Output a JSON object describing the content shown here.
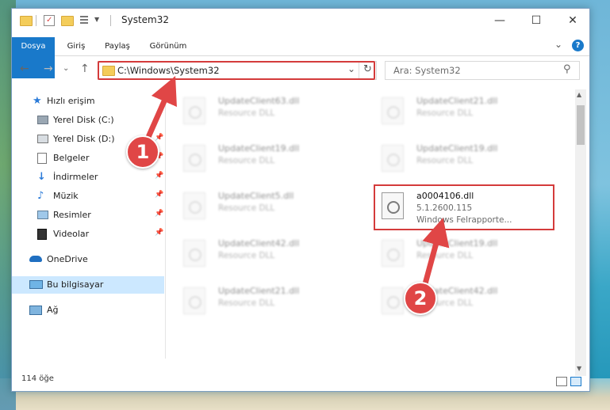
{
  "window": {
    "title": "System32",
    "controls": {
      "minimize": "—",
      "maximize": "☐",
      "close": "✕"
    }
  },
  "ribbon": {
    "tabs": [
      "Dosya",
      "Giriş",
      "Paylaş",
      "Görünüm"
    ],
    "expand": "⌄",
    "help": "?"
  },
  "nav": {
    "back": "←",
    "forward": "→",
    "dropdown": "⌄",
    "up": "↑",
    "address": "C:\\Windows\\System32",
    "address_dropdown": "⌄",
    "refresh": "↻",
    "search_placeholder": "Ara: System32",
    "search_icon": "⚲"
  },
  "sidebar": {
    "items": [
      {
        "label": "Hızlı erişim",
        "icon": "star-icon"
      },
      {
        "label": "Yerel Disk (C:)",
        "icon": "drive-icon",
        "pinned": true
      },
      {
        "label": "Yerel Disk (D:)",
        "icon": "drive-icon",
        "pinned": true
      },
      {
        "label": "Belgeler",
        "icon": "documents-icon",
        "pinned": true
      },
      {
        "label": "İndirmeler",
        "icon": "download-icon",
        "pinned": true
      },
      {
        "label": "Müzik",
        "icon": "music-icon",
        "pinned": true
      },
      {
        "label": "Resimler",
        "icon": "pictures-icon",
        "pinned": true
      },
      {
        "label": "Videolar",
        "icon": "video-icon",
        "pinned": true
      },
      {
        "label": "OneDrive",
        "icon": "cloud-icon"
      },
      {
        "label": "Bu bilgisayar",
        "icon": "computer-icon",
        "selected": true
      },
      {
        "label": "Ağ",
        "icon": "network-icon"
      }
    ]
  },
  "files": {
    "left": [
      {
        "name": "UpdateClient63.dll",
        "desc": "Resource DLL"
      },
      {
        "name": "UpdateClient19.dll",
        "desc": "Resource DLL"
      },
      {
        "name": "UpdateClient5.dll",
        "desc": "Resource DLL"
      },
      {
        "name": "UpdateClient42.dll",
        "desc": "Resource DLL"
      },
      {
        "name": "UpdateClient21.dll",
        "desc": "Resource DLL"
      }
    ],
    "right": [
      {
        "name": "UpdateClient21.dll",
        "desc": "Resource DLL"
      },
      {
        "name": "UpdateClient19.dll",
        "desc": "Resource DLL"
      },
      {
        "name": "UpdateClient19.dll",
        "desc": "Resource DLL"
      },
      {
        "name": "UpdateClient42.dll",
        "desc": "Resource DLL"
      }
    ],
    "highlighted": {
      "name": "a0004106.dll",
      "version": "5.1.2600.115",
      "company": "Windows Felrapporte..."
    }
  },
  "status": {
    "count": "114 öğe"
  },
  "annotations": {
    "step1": "1",
    "step2": "2",
    "color": "#d43b3b"
  }
}
